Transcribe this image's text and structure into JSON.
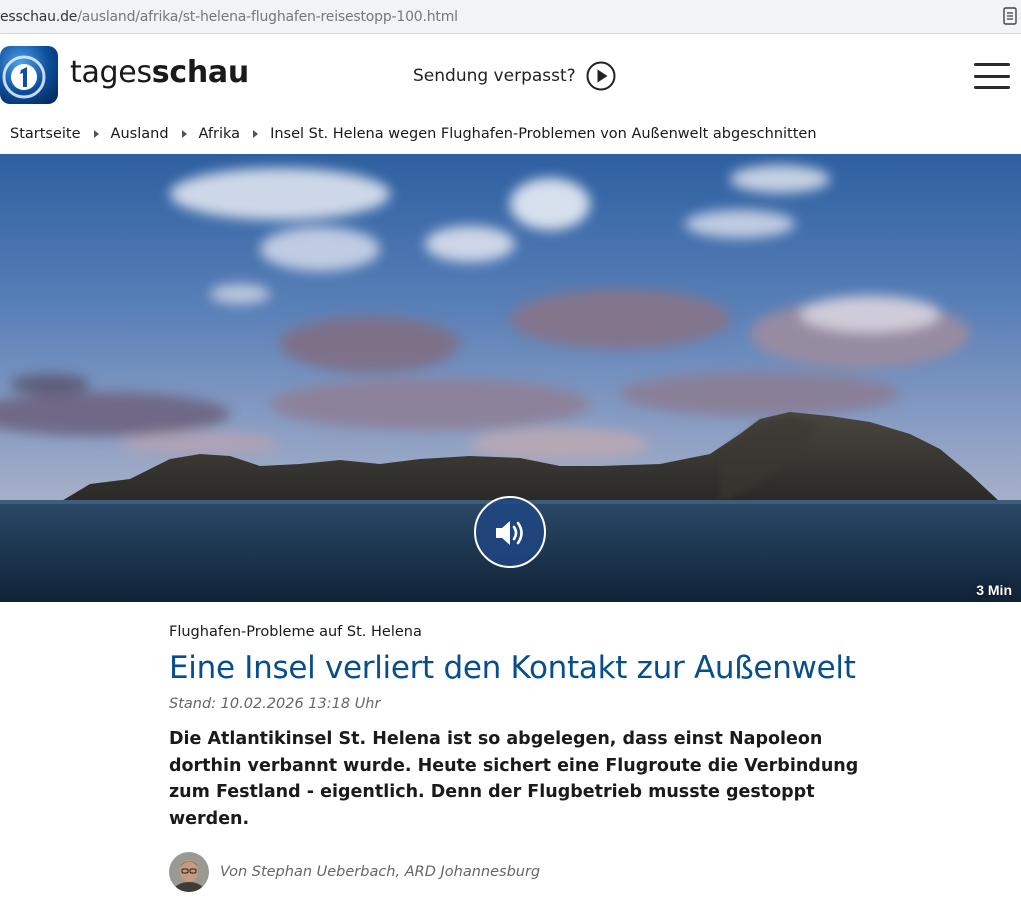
{
  "browser": {
    "url_host": "esschau.de",
    "url_path": "/ausland/afrika/st-helena-flughafen-reisestopp-100.html"
  },
  "header": {
    "brand_regular": "tages",
    "brand_bold": "schau",
    "sendung_label": "Sendung verpasst?",
    "brand_color": "#084d8c"
  },
  "breadcrumb": {
    "items": [
      "Startseite",
      "Ausland",
      "Afrika"
    ],
    "current": "Insel St. Helena wegen Flughafen-Problemen von Außenwelt abgeschnitten"
  },
  "hero": {
    "duration": "3 Min",
    "icons": [
      "speaker-icon"
    ]
  },
  "article": {
    "topline": "Flughafen-Probleme auf St. Helena",
    "headline": "Eine Insel verliert den Kontakt zur Außenwelt",
    "stand": "Stand: 10.02.2026 13:18 Uhr",
    "teaser": "Die Atlantikinsel St. Helena ist so abgelegen, dass einst Napoleon dorthin verbannt wurde. Heute sichert eine Flugroute die Verbindung zum Festland - eigentlich. Denn der Flugbetrieb musste gestoppt werden.",
    "author": "Von Stephan Ueberbach, ARD Johannesburg"
  }
}
